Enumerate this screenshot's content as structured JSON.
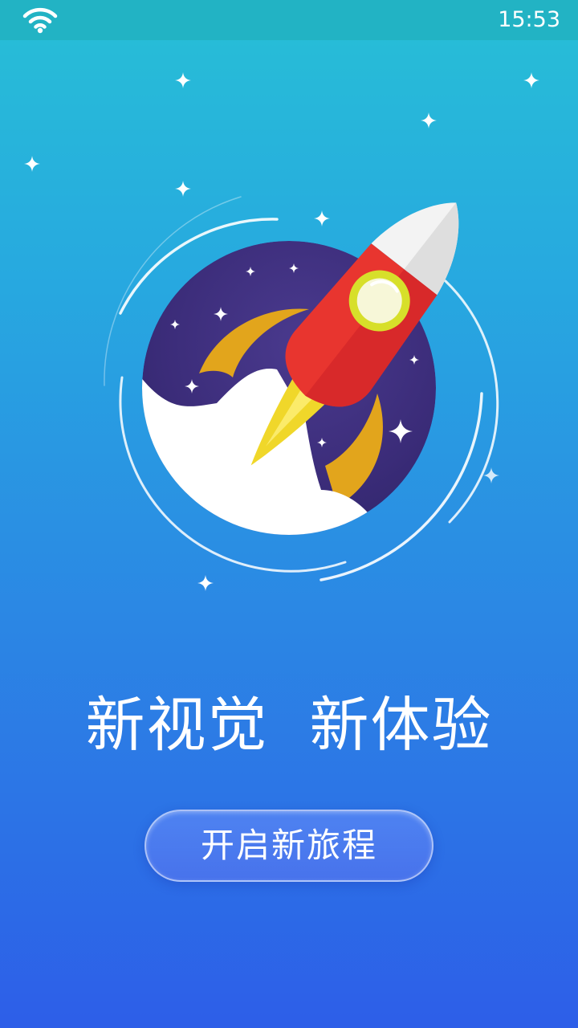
{
  "status_bar": {
    "time": "15:53",
    "wifi_icon": "wifi-icon"
  },
  "hero": {
    "illustration_icon": "rocket-launch-illustration",
    "colors": {
      "rocket_body": "#e8332f",
      "rocket_nose": "#f5f5f5",
      "flame": "#f0d72a",
      "moon": "#e3a31b",
      "night_sky": "#3a2a78",
      "cloud": "#ffffff"
    }
  },
  "main": {
    "tagline": "新视觉  新体验"
  },
  "action": {
    "start_label": "开启新旅程"
  },
  "colors": {
    "background_top": "#27bfd6",
    "background_bottom": "#2d5ee8",
    "status_bar": "#22b3c4"
  }
}
